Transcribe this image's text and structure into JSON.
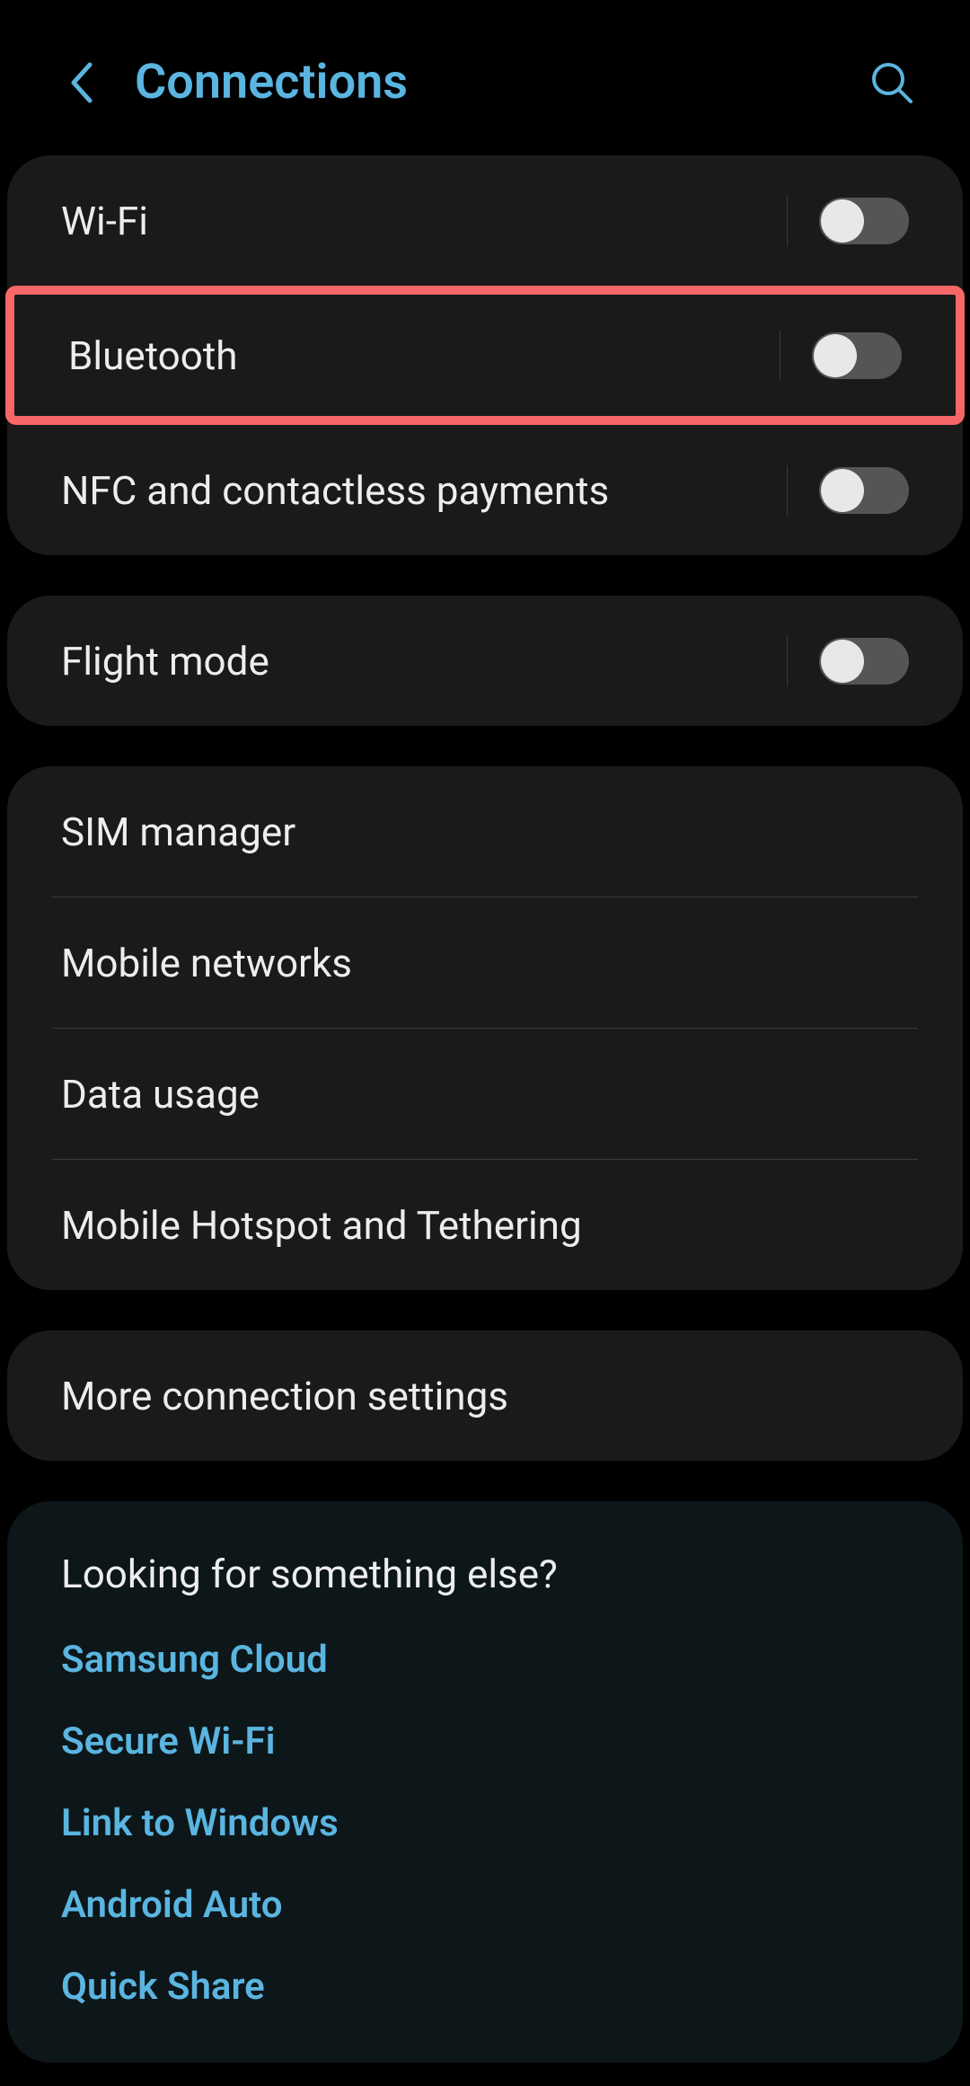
{
  "header": {
    "title": "Connections"
  },
  "groups": [
    {
      "items": [
        {
          "label": "Wi-Fi",
          "toggle": true,
          "highlighted": false
        },
        {
          "label": "Bluetooth",
          "toggle": true,
          "highlighted": true
        },
        {
          "label": "NFC and contactless payments",
          "toggle": true,
          "highlighted": false
        }
      ]
    },
    {
      "items": [
        {
          "label": "Flight mode",
          "toggle": true,
          "highlighted": false
        }
      ]
    },
    {
      "items": [
        {
          "label": "SIM manager",
          "toggle": false,
          "highlighted": false
        },
        {
          "label": "Mobile networks",
          "toggle": false,
          "highlighted": false
        },
        {
          "label": "Data usage",
          "toggle": false,
          "highlighted": false
        },
        {
          "label": "Mobile Hotspot and Tethering",
          "toggle": false,
          "highlighted": false
        }
      ]
    },
    {
      "items": [
        {
          "label": "More connection settings",
          "toggle": false,
          "highlighted": false
        }
      ]
    }
  ],
  "info": {
    "heading": "Looking for something else?",
    "links": [
      "Samsung Cloud",
      "Secure Wi-Fi",
      "Link to Windows",
      "Android Auto",
      "Quick Share"
    ]
  }
}
